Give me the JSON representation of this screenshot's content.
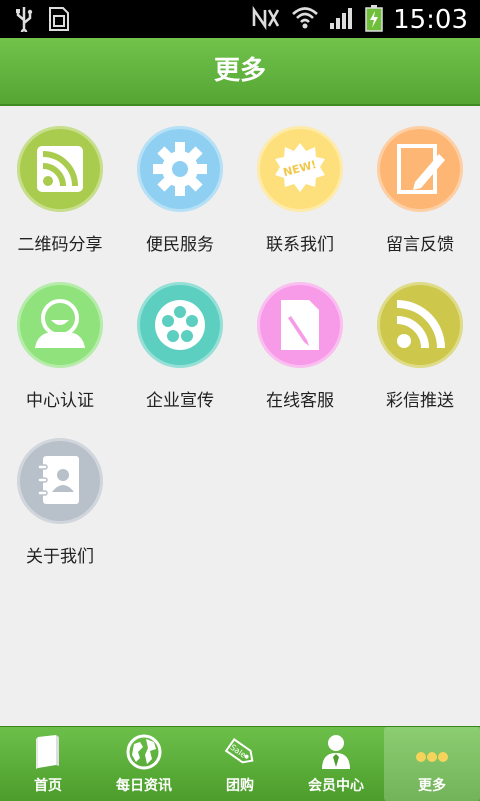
{
  "status_bar": {
    "time": "15:03"
  },
  "header": {
    "title": "更多"
  },
  "grid": {
    "items": [
      {
        "label": "二维码分享",
        "icon": "rss-square-icon",
        "color": "#a9cc4e"
      },
      {
        "label": "便民服务",
        "icon": "gear-icon",
        "color": "#8fd0f2"
      },
      {
        "label": "联系我们",
        "icon": "new-badge-icon",
        "color": "#fde07c",
        "badge": "NEW!"
      },
      {
        "label": "留言反馈",
        "icon": "edit-note-icon",
        "color": "#fdb673"
      },
      {
        "label": "中心认证",
        "icon": "user-icon",
        "color": "#8fe27c"
      },
      {
        "label": "企业宣传",
        "icon": "film-reel-icon",
        "color": "#5ccfc0"
      },
      {
        "label": "在线客服",
        "icon": "document-pen-icon",
        "color": "#f79be8"
      },
      {
        "label": "彩信推送",
        "icon": "rss-icon",
        "color": "#cdc84b"
      },
      {
        "label": "关于我们",
        "icon": "contact-book-icon",
        "color": "#b8c0c9"
      }
    ]
  },
  "bottom_nav": {
    "items": [
      {
        "label": "首页",
        "icon": "book-icon"
      },
      {
        "label": "每日资讯",
        "icon": "globe-icon"
      },
      {
        "label": "团购",
        "icon": "sale-tag-icon",
        "tag_text": "Sale"
      },
      {
        "label": "会员中心",
        "icon": "member-icon"
      },
      {
        "label": "更多",
        "icon": "more-dots-icon",
        "active": true
      }
    ]
  }
}
